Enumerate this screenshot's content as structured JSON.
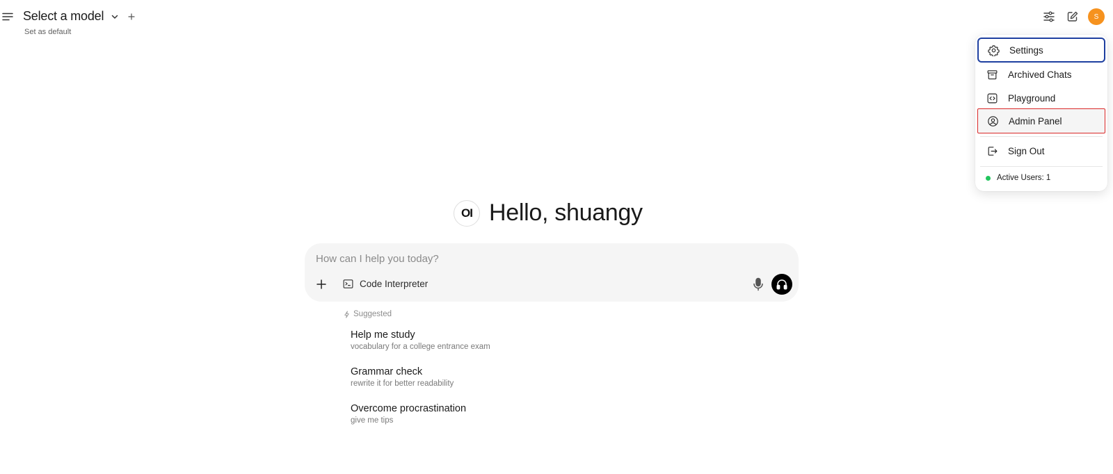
{
  "header": {
    "model_title": "Select a model",
    "set_default": "Set as default",
    "avatar_initial": "S",
    "avatar_color": "#f6921e"
  },
  "menu": {
    "items": [
      {
        "label": "Settings",
        "icon": "gear-icon"
      },
      {
        "label": "Archived Chats",
        "icon": "archive-icon"
      },
      {
        "label": "Playground",
        "icon": "code-icon"
      },
      {
        "label": "Admin Panel",
        "icon": "user-circle-icon"
      },
      {
        "label": "Sign Out",
        "icon": "sign-out-icon"
      }
    ],
    "active_users": "Active Users: 1",
    "status_color": "#22c55e"
  },
  "greeting": {
    "logo_text": "OI",
    "text": "Hello, shuangy"
  },
  "prompt": {
    "placeholder": "How can I help you today?",
    "code_interpreter": "Code Interpreter"
  },
  "suggestions": {
    "label": "Suggested",
    "items": [
      {
        "title": "Help me study",
        "subtitle": "vocabulary for a college entrance exam"
      },
      {
        "title": "Grammar check",
        "subtitle": "rewrite it for better readability"
      },
      {
        "title": "Overcome procrastination",
        "subtitle": "give me tips"
      }
    ]
  }
}
